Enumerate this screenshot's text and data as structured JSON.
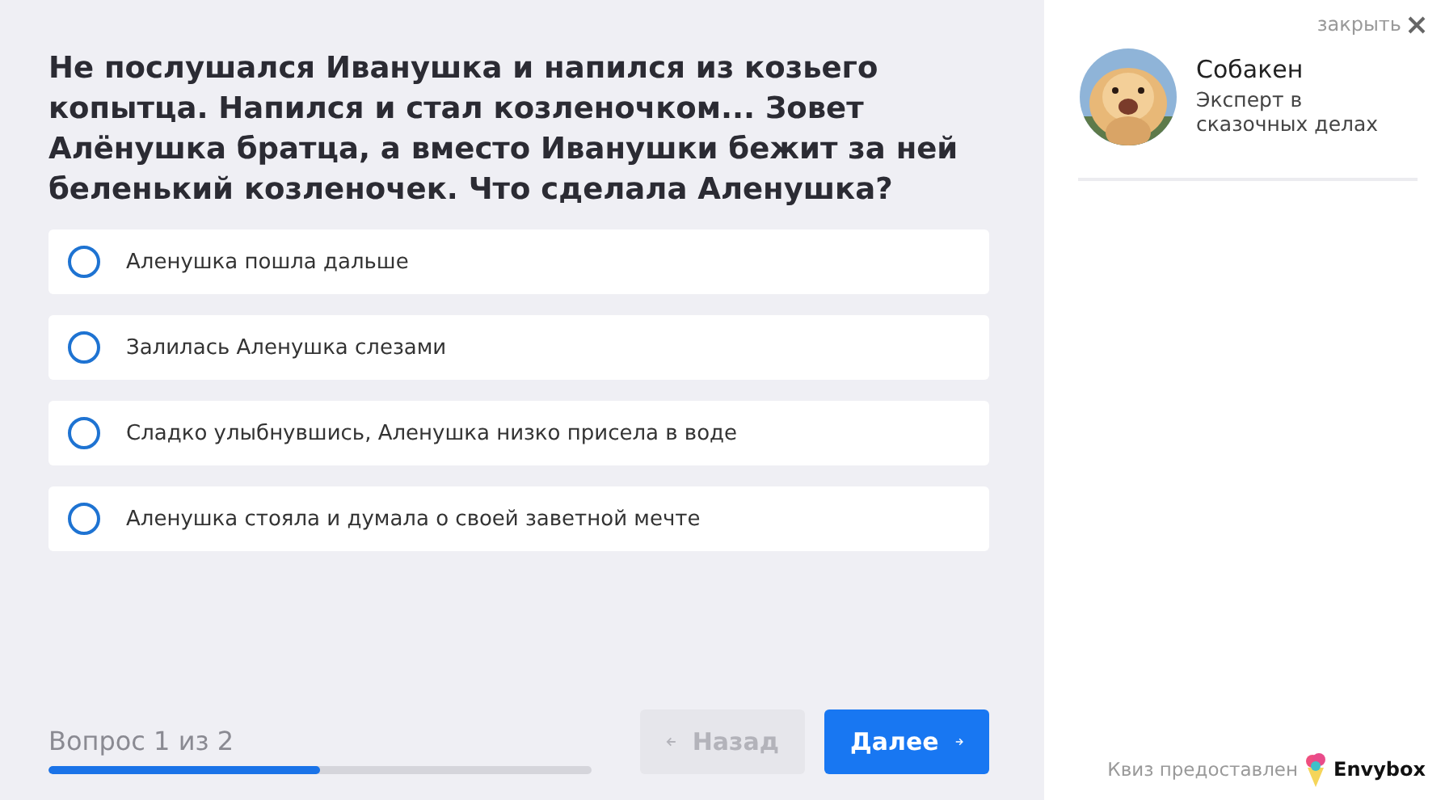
{
  "question": "Не послушался Иванушка и напился из козьего копытца. Напился и стал козленочком... Зовет Алёнушка братца, а вместо Иванушки бежит за ней беленький козленочек. Что сделала Аленушка?",
  "options": [
    {
      "label": "Аленушка пошла дальше",
      "selected": false
    },
    {
      "label": "Залилась Аленушка слезами",
      "selected": false
    },
    {
      "label": "Сладко улыбнувшись, Аленушка низко присела в воде",
      "selected": false
    },
    {
      "label": "Аленушка стояла и думала о своей заветной мечте",
      "selected": false
    }
  ],
  "progress": {
    "label": "Вопрос 1 из 2",
    "level": 0.5
  },
  "back_button": {
    "label": "Назад",
    "disabled": true
  },
  "next_button": {
    "label": "Далее",
    "disabled": false
  },
  "close": {
    "label": "закрыть"
  },
  "expert": {
    "name": "Собакен",
    "role": "Эксперт в сказочных делах"
  },
  "credit": {
    "label": "Квиз предоставлен",
    "brand": "Envybox"
  }
}
